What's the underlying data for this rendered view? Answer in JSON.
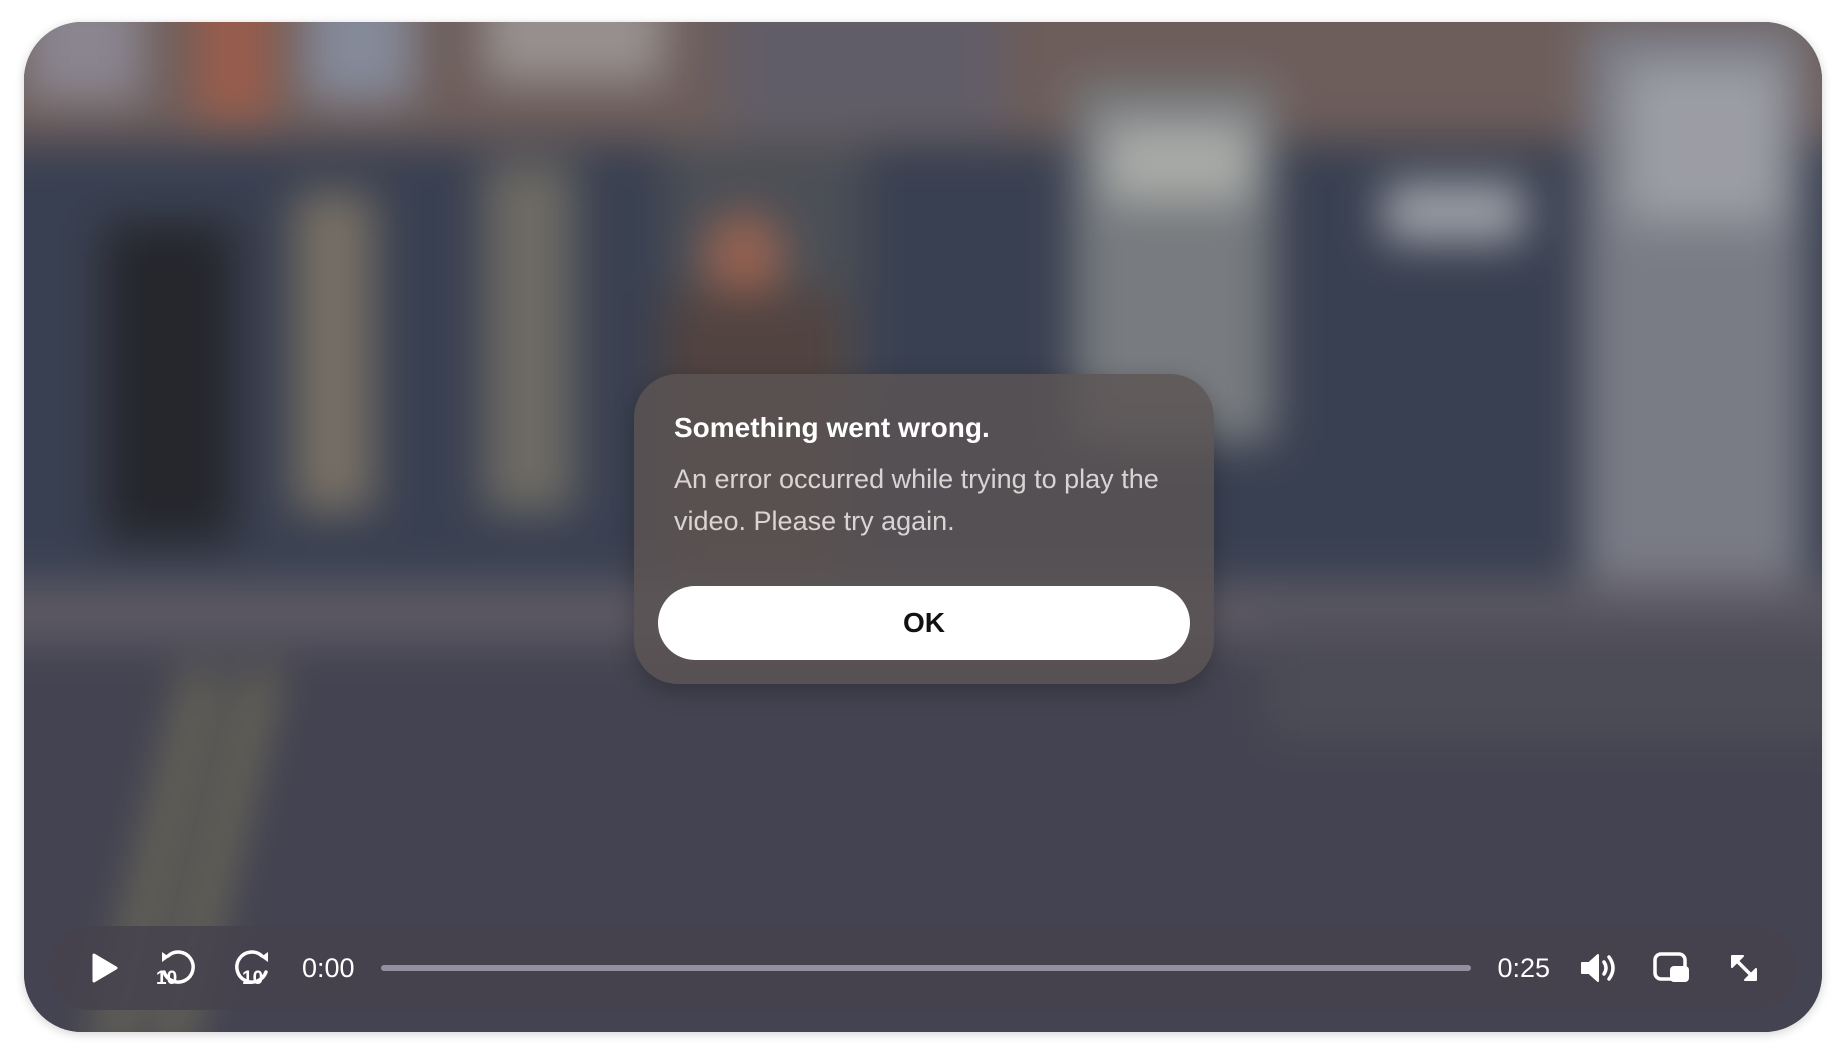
{
  "dialog": {
    "title": "Something went wrong.",
    "message": "An error occurred while trying to play the video. Please try again.",
    "ok_label": "OK"
  },
  "controls": {
    "play_icon": "play-icon",
    "rewind_seconds": "10",
    "forward_seconds": "10",
    "current_time": "0:00",
    "duration": "0:25",
    "progress_fraction": 0,
    "volume_icon": "volume-icon",
    "pip_icon": "picture-in-picture-icon",
    "fullscreen_icon": "fullscreen-icon"
  },
  "colors": {
    "dialog_bg": "#5c5454",
    "controls_bg": "#46424e",
    "button_bg": "#ffffff",
    "text_primary": "#ffffff"
  }
}
